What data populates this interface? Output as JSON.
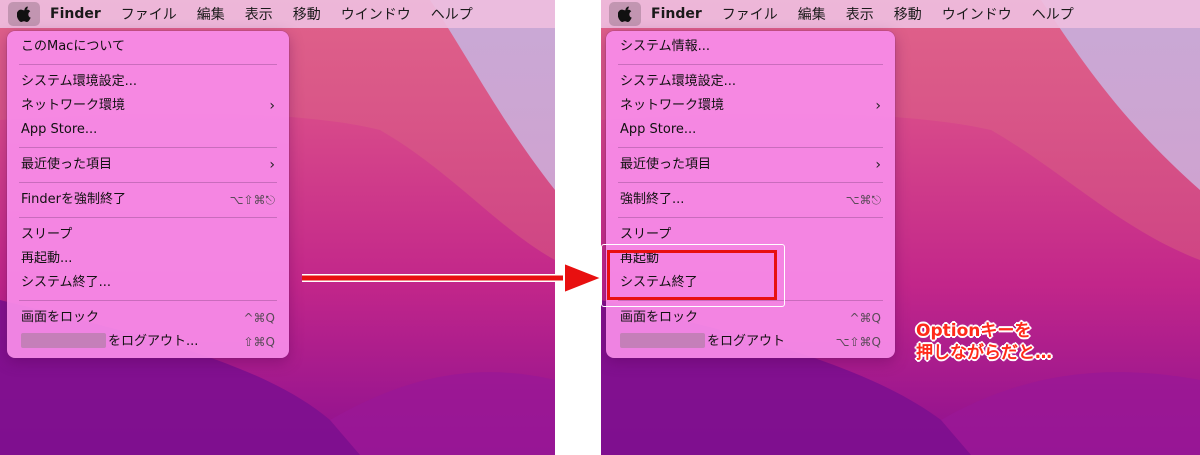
{
  "menubar": {
    "app_name": "Finder",
    "items": [
      "ファイル",
      "編集",
      "表示",
      "移動",
      "ウインドウ",
      "ヘルプ"
    ],
    "apple_icon": "apple-icon"
  },
  "left_menu": {
    "about": "このMacについて",
    "system_prefs": "システム環境設定...",
    "network": "ネットワーク環境",
    "app_store": "App Store...",
    "recent": "最近使った項目",
    "force_quit": "Finderを強制終了",
    "force_quit_shortcut": "⌥⇧⌘⎋",
    "sleep": "スリープ",
    "restart": "再起動...",
    "shutdown": "システム終了...",
    "lock": "画面をロック",
    "lock_shortcut": "^⌘Q",
    "logout": "をログアウト...",
    "logout_shortcut": "⇧⌘Q"
  },
  "right_menu": {
    "system_info": "システム情報...",
    "system_prefs": "システム環境設定...",
    "network": "ネットワーク環境",
    "app_store": "App Store...",
    "recent": "最近使った項目",
    "force_quit": "強制終了...",
    "force_quit_shortcut": "⌥⌘⎋",
    "sleep": "スリープ",
    "restart": "再起動",
    "shutdown": "システム終了",
    "lock": "画面をロック",
    "lock_shortcut": "^⌘Q",
    "logout": "をログアウト",
    "logout_shortcut": "⌥⇧⌘Q"
  },
  "annotation": {
    "line1": "Optionキーを",
    "line2": "押しながらだと…"
  },
  "colors": {
    "arrow": "#e81010",
    "highlight": "#e81010",
    "menu_bg": "#f78ce8"
  }
}
